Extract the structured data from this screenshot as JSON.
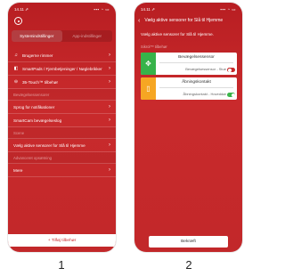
{
  "phone1": {
    "status": {
      "time": "14.11 ⇗",
      "icons": "▪▪▪ ◔ ▭"
    },
    "tabs": [
      {
        "label": "Systemindstillinger"
      },
      {
        "label": "App-indstillinger"
      }
    ],
    "menu": [
      {
        "icon": "♫",
        "label": "Brugerne rimmer",
        "chevron": "›"
      },
      {
        "icon": "◧",
        "label": "SmartPads / Fjernbetjeninger / Nøglebrikker",
        "chevron": "›"
      },
      {
        "icon": "⊖",
        "label": "35-Touch™ tilbehør",
        "chevron": "›"
      }
    ],
    "section1": "Bevægelsessensorer",
    "menu2": [
      {
        "label": "Sprog for notifikationer",
        "chevron": "›"
      },
      {
        "label": "SmartCam bevægelseslog",
        "chevron": "›"
      }
    ],
    "section2": "Scene",
    "menu3": [
      {
        "label": "Vælg aktive sensorer for Slå til Hjemme",
        "chevron": "›"
      }
    ],
    "section3": "Advanceret opsætning",
    "menu4": [
      {
        "label": "Mere",
        "chevron": "›"
      }
    ],
    "add_button": "+ Tilføj tilbehør"
  },
  "phone2": {
    "status": {
      "time": "14.11 ⇗",
      "icons": "▪▪▪ ◔ ▭"
    },
    "header_title": "Vælg aktive sensorer for Slå til Hjemme",
    "back_icon": "‹",
    "description": "Vælg aktive sensorer for Slå til Hjemme.",
    "section_label": "Sikrol™ tilbehør",
    "cards": [
      {
        "title": "Bevægelsessensor",
        "subtitle": "Bevægelsessensor - Stue",
        "side_icon": "✥",
        "toggle": "off"
      },
      {
        "title": "Åbningskontakt",
        "subtitle": "Åbningskontakt - Hoveddør",
        "side_icon": "▯",
        "toggle": "on"
      }
    ],
    "ok_button": "Bekræft"
  },
  "captions": [
    "1",
    "2"
  ],
  "colors": {
    "brand_red": "#c9282b",
    "green": "#37b34a",
    "orange": "#f6a623"
  }
}
